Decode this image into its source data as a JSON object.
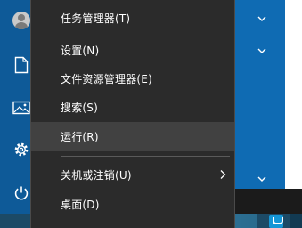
{
  "context_menu": {
    "items": [
      {
        "label": "任务管理器(T)"
      },
      {
        "label": "设置(N)"
      },
      {
        "label": "文件资源管理器(E)"
      },
      {
        "label": "搜索(S)"
      },
      {
        "label": "运行(R)"
      },
      {
        "label": "关机或注销(U)",
        "submenu": true
      },
      {
        "label": "桌面(D)"
      }
    ],
    "highlighted_item": "运行(R)"
  },
  "sidebar": {
    "icons": [
      "user-avatar-icon",
      "document-icon",
      "pictures-icon",
      "settings-gear-icon",
      "power-icon"
    ]
  },
  "colors": {
    "menu_background": "#2b2b2b",
    "menu_highlight": "#414141",
    "sidebar": "#0e5a98",
    "start_tiles": "#0f6bb3",
    "taskbar": "#1c4a66"
  }
}
